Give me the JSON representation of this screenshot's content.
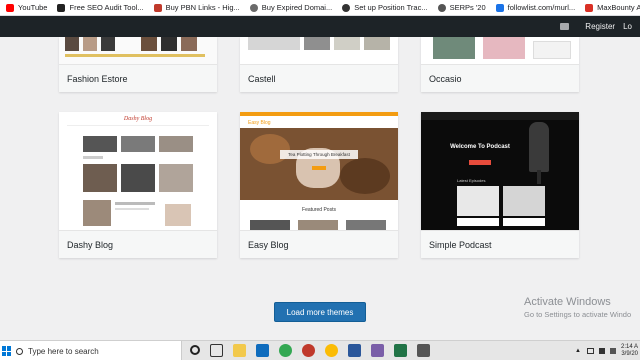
{
  "bookmarks": [
    {
      "label": "YouTube",
      "color": "#ff0000"
    },
    {
      "label": "Free SEO Audit Tool...",
      "color": "#222222"
    },
    {
      "label": "Buy PBN Links - Hig...",
      "color": "#c0392b"
    },
    {
      "label": "Buy Expired Domai...",
      "color": "#6a6a6a"
    },
    {
      "label": "Set up Position Trac...",
      "color": "#333333"
    },
    {
      "label": "SERPs '20",
      "color": "#555555"
    },
    {
      "label": "followlist.com/murl...",
      "color": "#1a73e8"
    },
    {
      "label": "MaxBounty Affiliate...",
      "color": "#d93025"
    }
  ],
  "adminbar": {
    "register": "Register",
    "login": "Lo"
  },
  "themes": [
    {
      "name": "Fashion Estore"
    },
    {
      "name": "Castell"
    },
    {
      "name": "Occasio"
    },
    {
      "name": "Dashy Blog",
      "preview_brand": "Dashy Blog"
    },
    {
      "name": "Easy Blog",
      "preview_brand": "Easy Blog",
      "hero_text": "Tea Plotting Through Breakfast",
      "section": "Featured Posts"
    },
    {
      "name": "Simple Podcast",
      "hero_text": "Welcome To Podcast",
      "section": "Latest Episodes"
    }
  ],
  "load_more": "Load more themes",
  "watermark": {
    "title": "Activate Windows",
    "subtitle": "Go to Settings to activate Windo"
  },
  "taskbar": {
    "search_placeholder": "Type here to search",
    "time": "2:14 A",
    "date": "3/9/20"
  }
}
